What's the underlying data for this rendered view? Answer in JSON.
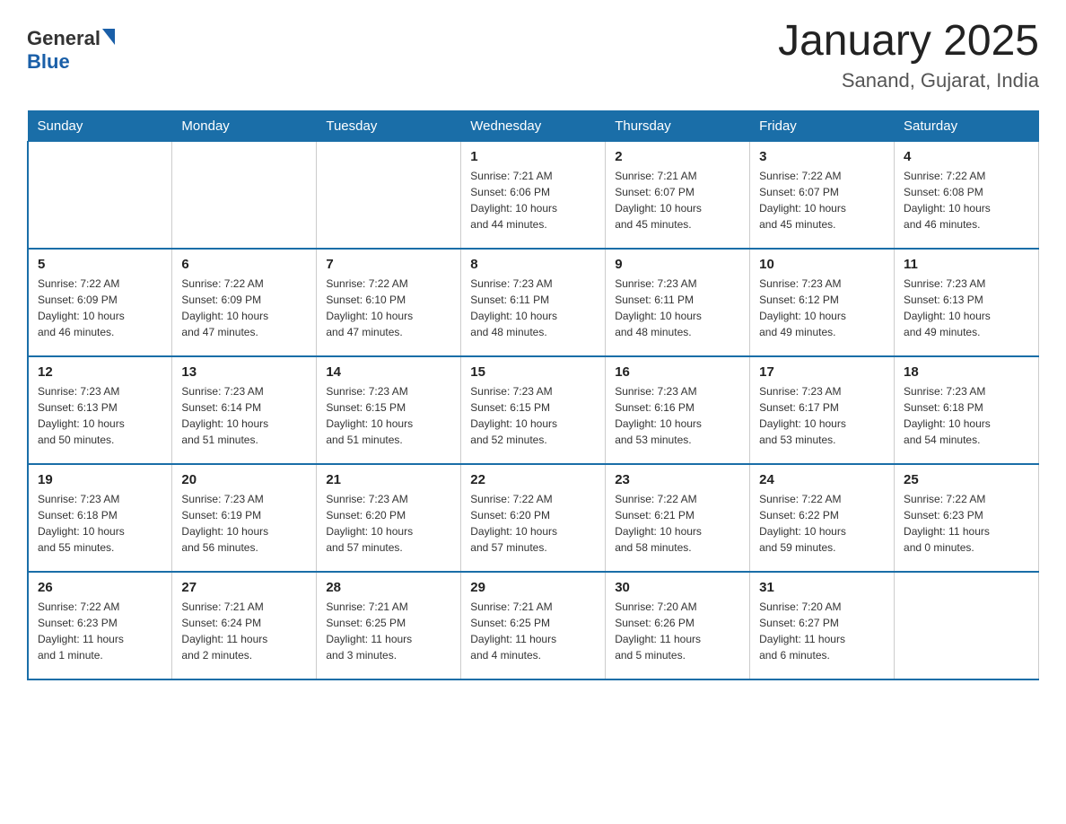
{
  "header": {
    "title": "January 2025",
    "subtitle": "Sanand, Gujarat, India",
    "logo_general": "General",
    "logo_blue": "Blue"
  },
  "days_of_week": [
    "Sunday",
    "Monday",
    "Tuesday",
    "Wednesday",
    "Thursday",
    "Friday",
    "Saturday"
  ],
  "weeks": [
    [
      {
        "day": "",
        "info": ""
      },
      {
        "day": "",
        "info": ""
      },
      {
        "day": "",
        "info": ""
      },
      {
        "day": "1",
        "info": "Sunrise: 7:21 AM\nSunset: 6:06 PM\nDaylight: 10 hours\nand 44 minutes."
      },
      {
        "day": "2",
        "info": "Sunrise: 7:21 AM\nSunset: 6:07 PM\nDaylight: 10 hours\nand 45 minutes."
      },
      {
        "day": "3",
        "info": "Sunrise: 7:22 AM\nSunset: 6:07 PM\nDaylight: 10 hours\nand 45 minutes."
      },
      {
        "day": "4",
        "info": "Sunrise: 7:22 AM\nSunset: 6:08 PM\nDaylight: 10 hours\nand 46 minutes."
      }
    ],
    [
      {
        "day": "5",
        "info": "Sunrise: 7:22 AM\nSunset: 6:09 PM\nDaylight: 10 hours\nand 46 minutes."
      },
      {
        "day": "6",
        "info": "Sunrise: 7:22 AM\nSunset: 6:09 PM\nDaylight: 10 hours\nand 47 minutes."
      },
      {
        "day": "7",
        "info": "Sunrise: 7:22 AM\nSunset: 6:10 PM\nDaylight: 10 hours\nand 47 minutes."
      },
      {
        "day": "8",
        "info": "Sunrise: 7:23 AM\nSunset: 6:11 PM\nDaylight: 10 hours\nand 48 minutes."
      },
      {
        "day": "9",
        "info": "Sunrise: 7:23 AM\nSunset: 6:11 PM\nDaylight: 10 hours\nand 48 minutes."
      },
      {
        "day": "10",
        "info": "Sunrise: 7:23 AM\nSunset: 6:12 PM\nDaylight: 10 hours\nand 49 minutes."
      },
      {
        "day": "11",
        "info": "Sunrise: 7:23 AM\nSunset: 6:13 PM\nDaylight: 10 hours\nand 49 minutes."
      }
    ],
    [
      {
        "day": "12",
        "info": "Sunrise: 7:23 AM\nSunset: 6:13 PM\nDaylight: 10 hours\nand 50 minutes."
      },
      {
        "day": "13",
        "info": "Sunrise: 7:23 AM\nSunset: 6:14 PM\nDaylight: 10 hours\nand 51 minutes."
      },
      {
        "day": "14",
        "info": "Sunrise: 7:23 AM\nSunset: 6:15 PM\nDaylight: 10 hours\nand 51 minutes."
      },
      {
        "day": "15",
        "info": "Sunrise: 7:23 AM\nSunset: 6:15 PM\nDaylight: 10 hours\nand 52 minutes."
      },
      {
        "day": "16",
        "info": "Sunrise: 7:23 AM\nSunset: 6:16 PM\nDaylight: 10 hours\nand 53 minutes."
      },
      {
        "day": "17",
        "info": "Sunrise: 7:23 AM\nSunset: 6:17 PM\nDaylight: 10 hours\nand 53 minutes."
      },
      {
        "day": "18",
        "info": "Sunrise: 7:23 AM\nSunset: 6:18 PM\nDaylight: 10 hours\nand 54 minutes."
      }
    ],
    [
      {
        "day": "19",
        "info": "Sunrise: 7:23 AM\nSunset: 6:18 PM\nDaylight: 10 hours\nand 55 minutes."
      },
      {
        "day": "20",
        "info": "Sunrise: 7:23 AM\nSunset: 6:19 PM\nDaylight: 10 hours\nand 56 minutes."
      },
      {
        "day": "21",
        "info": "Sunrise: 7:23 AM\nSunset: 6:20 PM\nDaylight: 10 hours\nand 57 minutes."
      },
      {
        "day": "22",
        "info": "Sunrise: 7:22 AM\nSunset: 6:20 PM\nDaylight: 10 hours\nand 57 minutes."
      },
      {
        "day": "23",
        "info": "Sunrise: 7:22 AM\nSunset: 6:21 PM\nDaylight: 10 hours\nand 58 minutes."
      },
      {
        "day": "24",
        "info": "Sunrise: 7:22 AM\nSunset: 6:22 PM\nDaylight: 10 hours\nand 59 minutes."
      },
      {
        "day": "25",
        "info": "Sunrise: 7:22 AM\nSunset: 6:23 PM\nDaylight: 11 hours\nand 0 minutes."
      }
    ],
    [
      {
        "day": "26",
        "info": "Sunrise: 7:22 AM\nSunset: 6:23 PM\nDaylight: 11 hours\nand 1 minute."
      },
      {
        "day": "27",
        "info": "Sunrise: 7:21 AM\nSunset: 6:24 PM\nDaylight: 11 hours\nand 2 minutes."
      },
      {
        "day": "28",
        "info": "Sunrise: 7:21 AM\nSunset: 6:25 PM\nDaylight: 11 hours\nand 3 minutes."
      },
      {
        "day": "29",
        "info": "Sunrise: 7:21 AM\nSunset: 6:25 PM\nDaylight: 11 hours\nand 4 minutes."
      },
      {
        "day": "30",
        "info": "Sunrise: 7:20 AM\nSunset: 6:26 PM\nDaylight: 11 hours\nand 5 minutes."
      },
      {
        "day": "31",
        "info": "Sunrise: 7:20 AM\nSunset: 6:27 PM\nDaylight: 11 hours\nand 6 minutes."
      },
      {
        "day": "",
        "info": ""
      }
    ]
  ]
}
